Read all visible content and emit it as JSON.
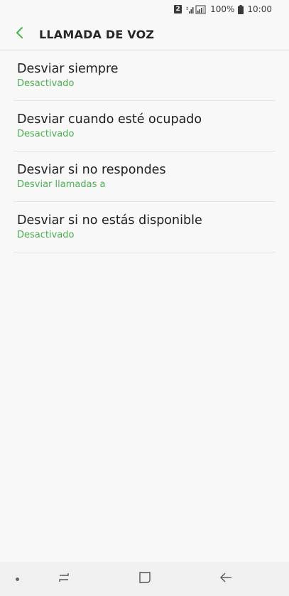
{
  "status_bar": {
    "sim_slot": "2",
    "battery": "100%",
    "time": "10:00"
  },
  "header": {
    "title": "LLAMADA DE VOZ",
    "back_icon": "chevron-left-icon"
  },
  "colors": {
    "accent": "#4caf50",
    "title_text": "#1e1e1e",
    "background": "#f8f8f8"
  },
  "items": [
    {
      "title": "Desviar siempre",
      "subtitle": "Desactivado"
    },
    {
      "title": "Desviar cuando esté ocupado",
      "subtitle": "Desactivado"
    },
    {
      "title": "Desviar si no respondes",
      "subtitle": "Desviar llamadas a"
    },
    {
      "title": "Desviar si no estás disponible",
      "subtitle": "Desactivado"
    }
  ],
  "nav_bar": {
    "icons": [
      "dot-icon",
      "recent-apps-icon",
      "home-icon",
      "back-arrow-icon"
    ]
  }
}
